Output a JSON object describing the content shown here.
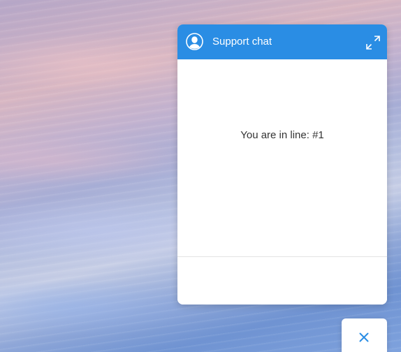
{
  "chat": {
    "title": "Support chat",
    "queue_status": "You are in line: #1",
    "accent_color": "#2a8de4"
  },
  "icons": {
    "avatar": "user-silhouette-icon",
    "expand": "expand-arrows-icon",
    "close": "close-x-icon"
  }
}
